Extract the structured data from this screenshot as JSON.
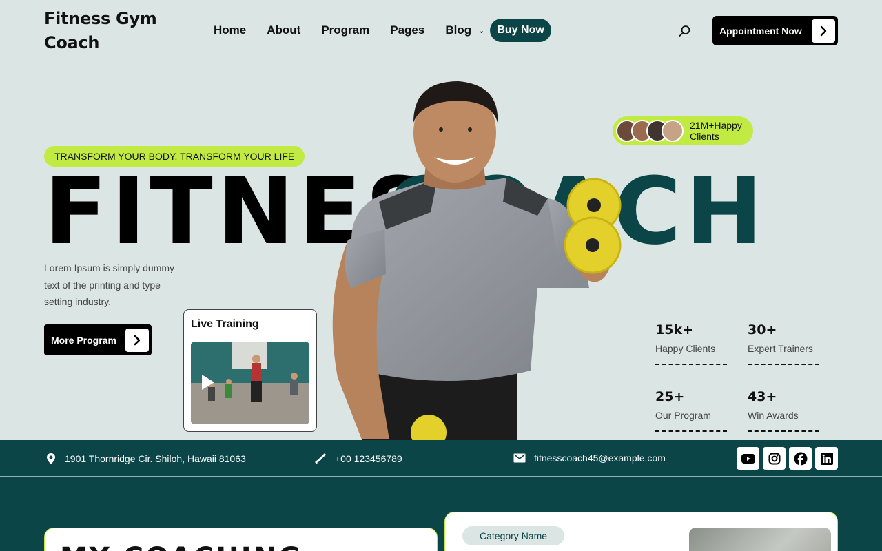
{
  "header": {
    "logo": "Fitness Gym Coach",
    "nav": [
      "Home",
      "About",
      "Program",
      "Pages",
      "Blog"
    ],
    "buy_now": "Buy Now",
    "appointment": "Appointment Now"
  },
  "hero": {
    "tagline": "TRANSFORM YOUR BODY. TRANSFORM YOUR LIFE",
    "word1": "FITNESS",
    "word2": "COACH",
    "description": "Lorem Ipsum is simply dummy text of the printing and type setting industry.",
    "more_program": "More Program",
    "live_training": "Live Training",
    "happy_pill": [
      "21M+Happy",
      "Clients"
    ]
  },
  "stats": [
    {
      "value": "15k+",
      "label": "Happy Clients"
    },
    {
      "value": "30+",
      "label": "Expert Trainers"
    },
    {
      "value": "25+",
      "label": "Our Program"
    },
    {
      "value": "43+",
      "label": "Win Awards"
    }
  ],
  "contact": {
    "address": "1901 Thornridge Cir. Shiloh, Hawaii 81063",
    "phone": "+00 123456789",
    "email": "fitnesscoach45@example.com"
  },
  "social_icons": [
    "youtube-icon",
    "instagram-icon",
    "facebook-icon",
    "linkedin-icon"
  ],
  "bottom": {
    "coaching_title": "MY COACHING",
    "category_name": "Category Name"
  },
  "colors": {
    "background": "#dbe5e3",
    "dark_teal": "#0b4548",
    "lime": "#c1ea43"
  }
}
